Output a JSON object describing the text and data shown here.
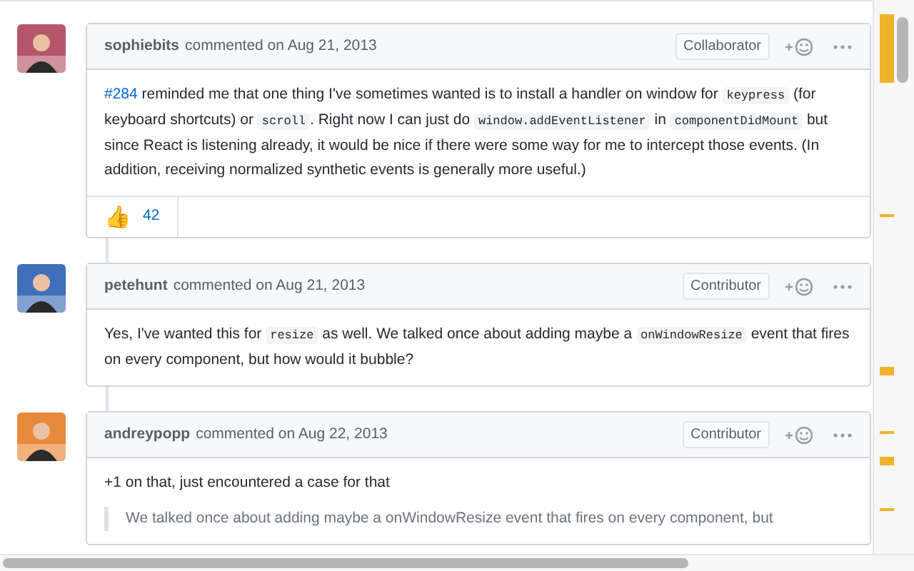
{
  "comments": [
    {
      "author": "sophiebits",
      "action": "commented on",
      "date": "Aug 21, 2013",
      "role": "Collaborator",
      "avatar": {
        "kind": "picture",
        "color": "#b5566a"
      },
      "body": [
        {
          "kind": "para",
          "parts": [
            {
              "kind": "link",
              "text": "#284"
            },
            {
              "kind": "text",
              "text": " reminded me that one thing I've sometimes wanted is to install a handler on window for "
            },
            {
              "kind": "code",
              "text": "keypress"
            },
            {
              "kind": "text",
              "text": " (for keyboard shortcuts) or "
            },
            {
              "kind": "code",
              "text": "scroll"
            },
            {
              "kind": "text",
              "text": ". Right now I can just do "
            },
            {
              "kind": "code",
              "text": "window.addEventListener"
            },
            {
              "kind": "text",
              "text": " in "
            },
            {
              "kind": "code",
              "text": "componentDidMount"
            },
            {
              "kind": "text",
              "text": " but since React is listening already, it would be nice if there were some way for me to intercept those events. (In addition, receiving normalized synthetic events is generally more useful.)"
            }
          ]
        }
      ],
      "reactions": [
        {
          "emoji": "👍",
          "count": "42"
        }
      ]
    },
    {
      "author": "petehunt",
      "action": "commented on",
      "date": "Aug 21, 2013",
      "role": "Contributor",
      "avatar": {
        "kind": "picture",
        "color": "#3f6fb8"
      },
      "body": [
        {
          "kind": "para",
          "parts": [
            {
              "kind": "text",
              "text": "Yes, I've wanted this for "
            },
            {
              "kind": "code",
              "text": "resize"
            },
            {
              "kind": "text",
              "text": " as well. We talked once about adding maybe a "
            },
            {
              "kind": "code",
              "text": "onWindowResize"
            },
            {
              "kind": "text",
              "text": " event that fires on every component, but how would it bubble?"
            }
          ]
        }
      ]
    },
    {
      "author": "andreypopp",
      "action": "commented on",
      "date": "Aug 22, 2013",
      "role": "Contributor",
      "avatar": {
        "kind": "picture",
        "color": "#e8883a"
      },
      "body": [
        {
          "kind": "para",
          "parts": [
            {
              "kind": "text",
              "text": "+1 on that, just encountered a case for that"
            }
          ]
        },
        {
          "kind": "quote",
          "parts": [
            {
              "kind": "text",
              "text": "We talked once about adding maybe a onWindowResize event that fires on every component, but"
            }
          ]
        }
      ]
    }
  ]
}
